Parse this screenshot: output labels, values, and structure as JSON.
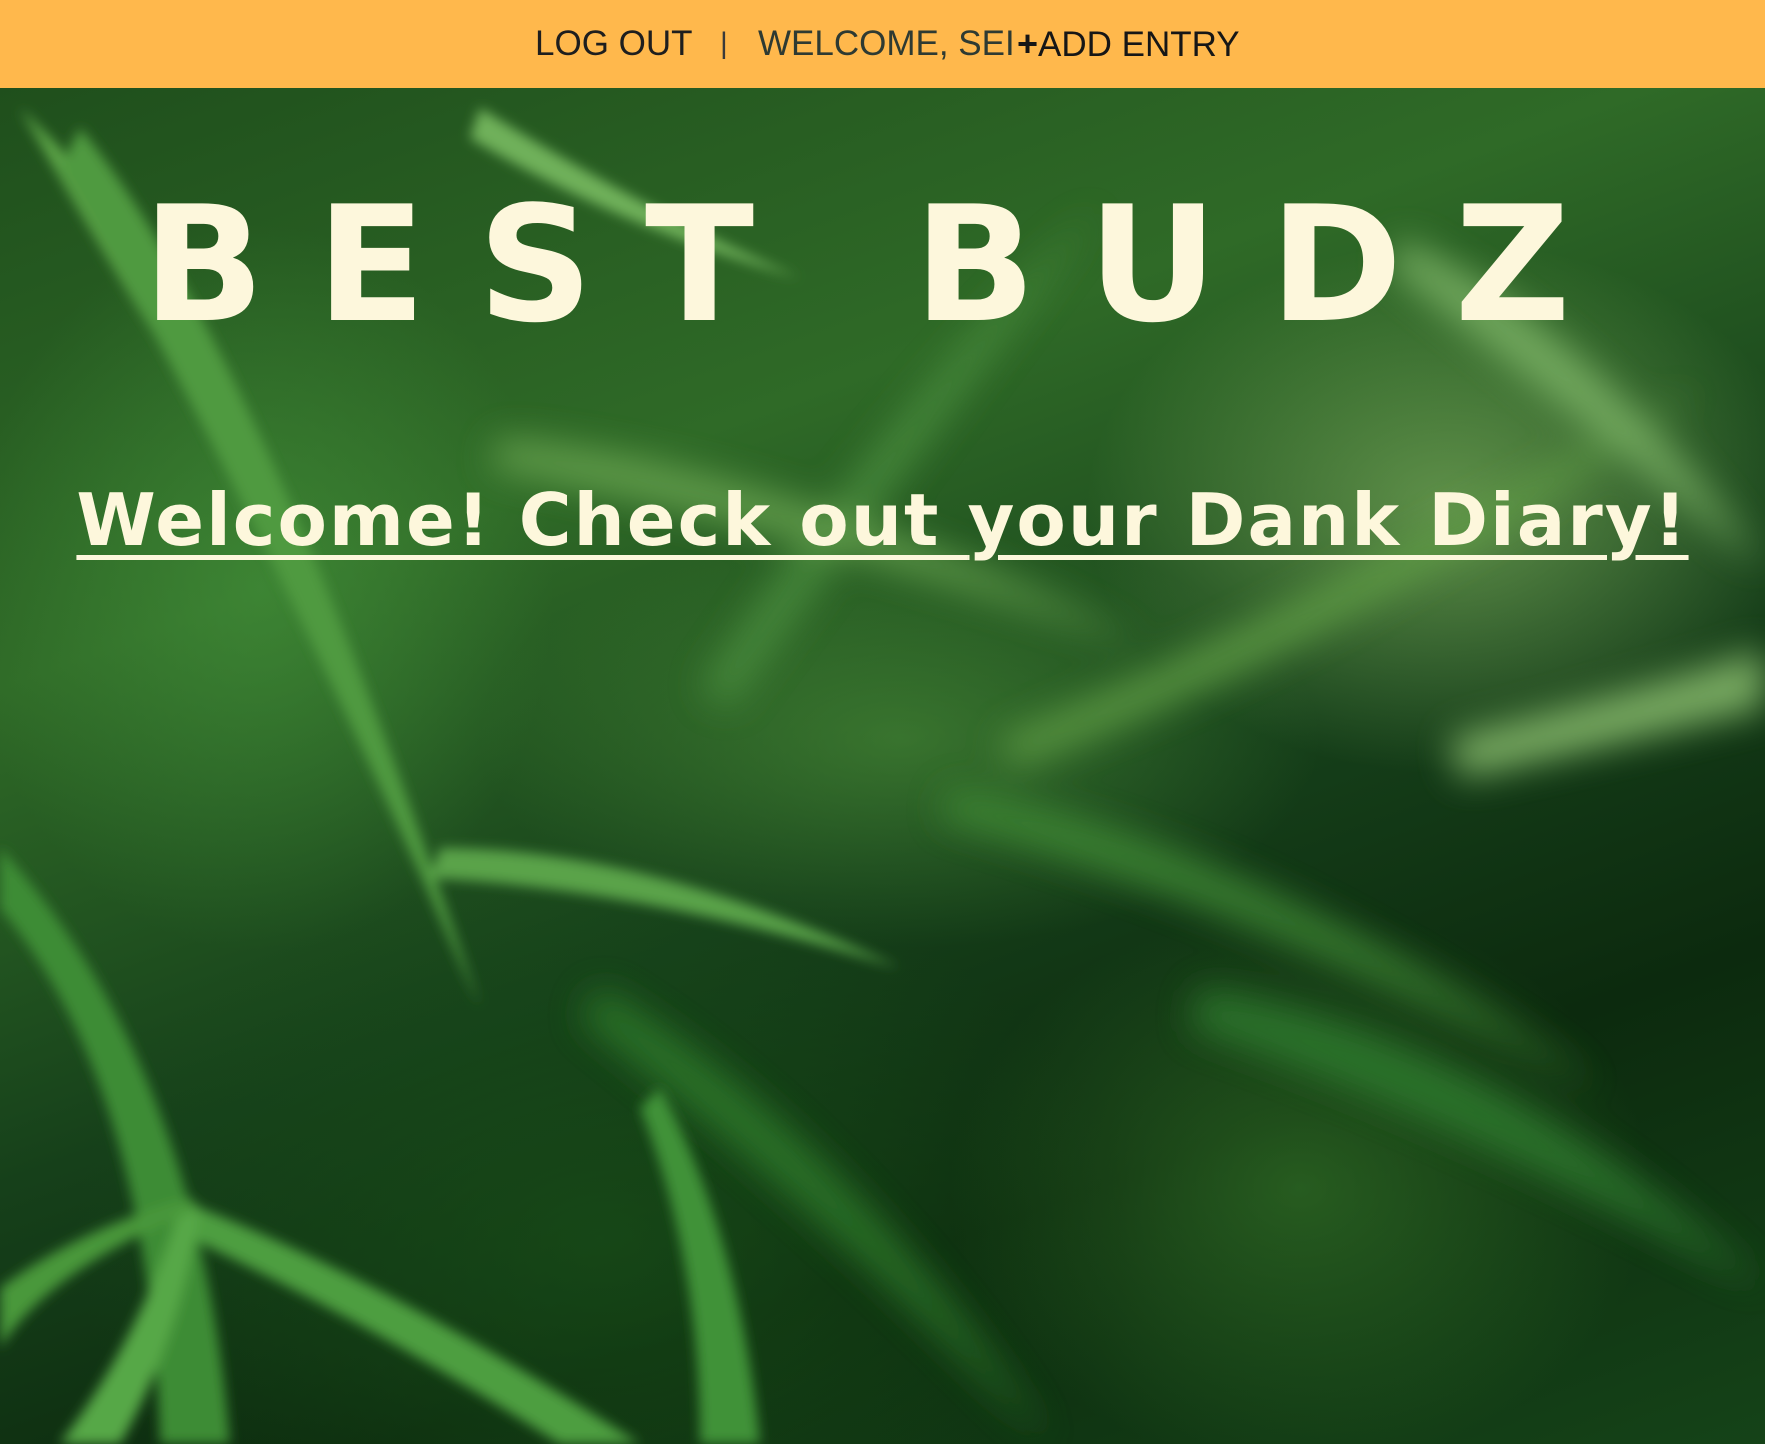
{
  "nav": {
    "logout_label": "LOG OUT",
    "separator": "|",
    "welcome_text": "WELCOME, SEI",
    "add_plus": "+",
    "add_label": "ADD ENTRY"
  },
  "hero": {
    "title": "BEST BUDZ",
    "welcome_prefix": "Welcome! Check out ",
    "welcome_link": "your Dank Diary!"
  },
  "colors": {
    "navbar_bg": "#ffb84c",
    "title_text": "#fdf7dc",
    "background_leaves": "#2f6a27"
  },
  "icons": {
    "background_image": "cannabis-leaves-photo"
  }
}
